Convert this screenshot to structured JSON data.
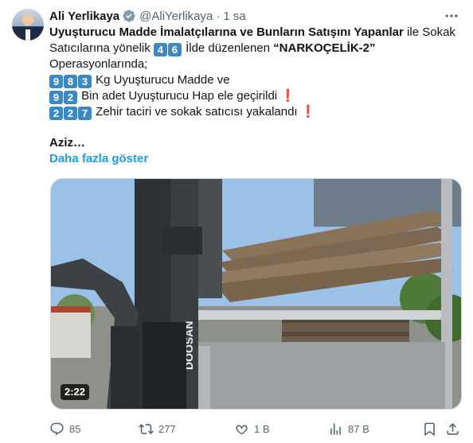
{
  "author": {
    "name": "Ali Yerlikaya",
    "handle": "@AliYerlikaya",
    "separator": "·",
    "time": "1 sa"
  },
  "post": {
    "line1_bold": "Uyuşturucu Madde İmalatçılarına ve Bunların Satışını Yapanlar",
    "line1_rest": " ile Sokak",
    "line2_start": "Satıcılarına yönelik ",
    "line2_keys": [
      "4",
      "6"
    ],
    "line2_mid": " İlde düzenlenen ",
    "line2_bold": "“NARKOÇELİK-2”",
    "line3": "Operasyonlarında;",
    "row1_keys": [
      "9",
      "8",
      "3"
    ],
    "row1_text": " Kg Uyuşturucu Madde ve",
    "row2_keys": [
      "9",
      "2"
    ],
    "row2_text": " Bin adet Uyuşturucu Hap ele geçirildi ",
    "row2_mark": "❗",
    "row3_keys": [
      "2",
      "2",
      "7"
    ],
    "row3_text": " Zehir taciri ve sokak satıcısı yakalandı ",
    "row3_mark": "❗",
    "truncated": "Aziz…",
    "show_more": "Daha fazla göster"
  },
  "media": {
    "duration": "2:22",
    "forklift_brand": "DOOSAN"
  },
  "actions": {
    "replies": "85",
    "reposts": "277",
    "likes": "1 B",
    "views": "87 B"
  },
  "colors": {
    "accent": "#1d9bf0",
    "keycap": "#3b88c3",
    "exclamation": "#dd2e44",
    "secondary_text": "#536471",
    "verified_badge": "#829aab"
  },
  "icons": [
    "verified-badge-icon",
    "more-icon",
    "reply-icon",
    "repost-icon",
    "like-icon",
    "views-icon",
    "bookmark-icon",
    "share-icon"
  ]
}
